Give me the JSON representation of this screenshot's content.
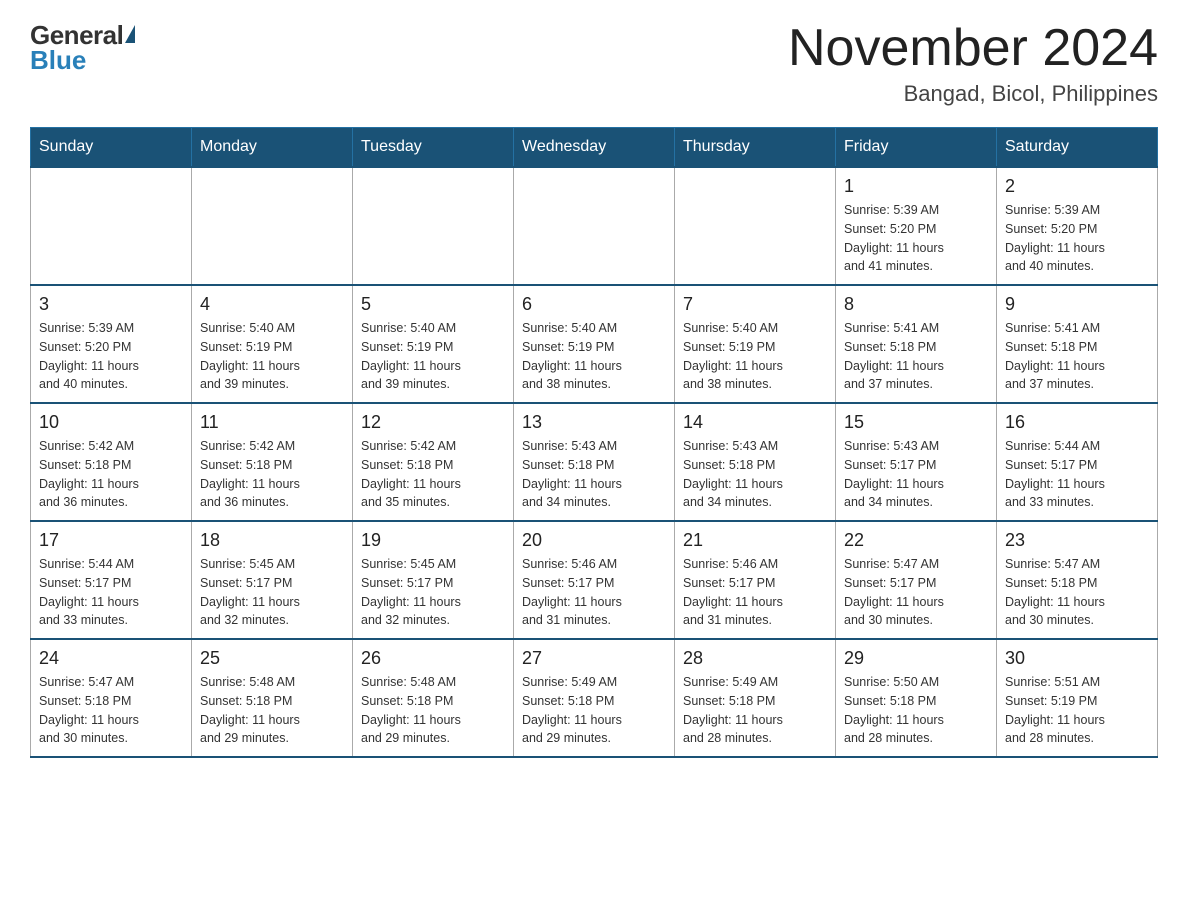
{
  "header": {
    "logo": {
      "general": "General",
      "blue": "Blue"
    },
    "month_title": "November 2024",
    "location": "Bangad, Bicol, Philippines"
  },
  "calendar": {
    "days_of_week": [
      "Sunday",
      "Monday",
      "Tuesday",
      "Wednesday",
      "Thursday",
      "Friday",
      "Saturday"
    ],
    "weeks": [
      [
        {
          "day": "",
          "info": ""
        },
        {
          "day": "",
          "info": ""
        },
        {
          "day": "",
          "info": ""
        },
        {
          "day": "",
          "info": ""
        },
        {
          "day": "",
          "info": ""
        },
        {
          "day": "1",
          "info": "Sunrise: 5:39 AM\nSunset: 5:20 PM\nDaylight: 11 hours\nand 41 minutes."
        },
        {
          "day": "2",
          "info": "Sunrise: 5:39 AM\nSunset: 5:20 PM\nDaylight: 11 hours\nand 40 minutes."
        }
      ],
      [
        {
          "day": "3",
          "info": "Sunrise: 5:39 AM\nSunset: 5:20 PM\nDaylight: 11 hours\nand 40 minutes."
        },
        {
          "day": "4",
          "info": "Sunrise: 5:40 AM\nSunset: 5:19 PM\nDaylight: 11 hours\nand 39 minutes."
        },
        {
          "day": "5",
          "info": "Sunrise: 5:40 AM\nSunset: 5:19 PM\nDaylight: 11 hours\nand 39 minutes."
        },
        {
          "day": "6",
          "info": "Sunrise: 5:40 AM\nSunset: 5:19 PM\nDaylight: 11 hours\nand 38 minutes."
        },
        {
          "day": "7",
          "info": "Sunrise: 5:40 AM\nSunset: 5:19 PM\nDaylight: 11 hours\nand 38 minutes."
        },
        {
          "day": "8",
          "info": "Sunrise: 5:41 AM\nSunset: 5:18 PM\nDaylight: 11 hours\nand 37 minutes."
        },
        {
          "day": "9",
          "info": "Sunrise: 5:41 AM\nSunset: 5:18 PM\nDaylight: 11 hours\nand 37 minutes."
        }
      ],
      [
        {
          "day": "10",
          "info": "Sunrise: 5:42 AM\nSunset: 5:18 PM\nDaylight: 11 hours\nand 36 minutes."
        },
        {
          "day": "11",
          "info": "Sunrise: 5:42 AM\nSunset: 5:18 PM\nDaylight: 11 hours\nand 36 minutes."
        },
        {
          "day": "12",
          "info": "Sunrise: 5:42 AM\nSunset: 5:18 PM\nDaylight: 11 hours\nand 35 minutes."
        },
        {
          "day": "13",
          "info": "Sunrise: 5:43 AM\nSunset: 5:18 PM\nDaylight: 11 hours\nand 34 minutes."
        },
        {
          "day": "14",
          "info": "Sunrise: 5:43 AM\nSunset: 5:18 PM\nDaylight: 11 hours\nand 34 minutes."
        },
        {
          "day": "15",
          "info": "Sunrise: 5:43 AM\nSunset: 5:17 PM\nDaylight: 11 hours\nand 34 minutes."
        },
        {
          "day": "16",
          "info": "Sunrise: 5:44 AM\nSunset: 5:17 PM\nDaylight: 11 hours\nand 33 minutes."
        }
      ],
      [
        {
          "day": "17",
          "info": "Sunrise: 5:44 AM\nSunset: 5:17 PM\nDaylight: 11 hours\nand 33 minutes."
        },
        {
          "day": "18",
          "info": "Sunrise: 5:45 AM\nSunset: 5:17 PM\nDaylight: 11 hours\nand 32 minutes."
        },
        {
          "day": "19",
          "info": "Sunrise: 5:45 AM\nSunset: 5:17 PM\nDaylight: 11 hours\nand 32 minutes."
        },
        {
          "day": "20",
          "info": "Sunrise: 5:46 AM\nSunset: 5:17 PM\nDaylight: 11 hours\nand 31 minutes."
        },
        {
          "day": "21",
          "info": "Sunrise: 5:46 AM\nSunset: 5:17 PM\nDaylight: 11 hours\nand 31 minutes."
        },
        {
          "day": "22",
          "info": "Sunrise: 5:47 AM\nSunset: 5:17 PM\nDaylight: 11 hours\nand 30 minutes."
        },
        {
          "day": "23",
          "info": "Sunrise: 5:47 AM\nSunset: 5:18 PM\nDaylight: 11 hours\nand 30 minutes."
        }
      ],
      [
        {
          "day": "24",
          "info": "Sunrise: 5:47 AM\nSunset: 5:18 PM\nDaylight: 11 hours\nand 30 minutes."
        },
        {
          "day": "25",
          "info": "Sunrise: 5:48 AM\nSunset: 5:18 PM\nDaylight: 11 hours\nand 29 minutes."
        },
        {
          "day": "26",
          "info": "Sunrise: 5:48 AM\nSunset: 5:18 PM\nDaylight: 11 hours\nand 29 minutes."
        },
        {
          "day": "27",
          "info": "Sunrise: 5:49 AM\nSunset: 5:18 PM\nDaylight: 11 hours\nand 29 minutes."
        },
        {
          "day": "28",
          "info": "Sunrise: 5:49 AM\nSunset: 5:18 PM\nDaylight: 11 hours\nand 28 minutes."
        },
        {
          "day": "29",
          "info": "Sunrise: 5:50 AM\nSunset: 5:18 PM\nDaylight: 11 hours\nand 28 minutes."
        },
        {
          "day": "30",
          "info": "Sunrise: 5:51 AM\nSunset: 5:19 PM\nDaylight: 11 hours\nand 28 minutes."
        }
      ]
    ]
  }
}
